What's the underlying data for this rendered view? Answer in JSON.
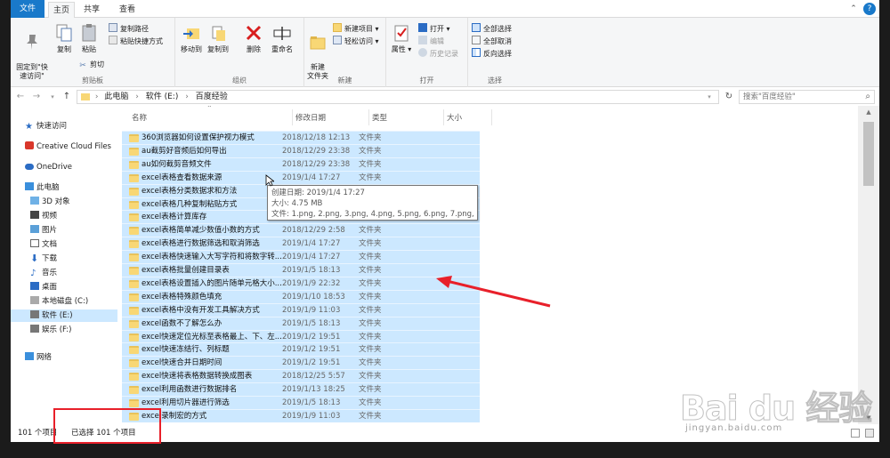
{
  "tabs": {
    "file": "文件",
    "home": "主页",
    "share": "共享",
    "view": "查看"
  },
  "ribbon": {
    "clipboard": {
      "label": "剪贴板",
      "pin": "固定到\"快\n速访问\"",
      "copy": "复制",
      "paste": "粘贴",
      "copy_path": "复制路径",
      "paste_shortcut": "粘贴快捷方式",
      "cut": "剪切"
    },
    "organize": {
      "label": "组织",
      "move_to": "移动到",
      "copy_to": "复制到",
      "delete": "删除",
      "rename": "重命名"
    },
    "new": {
      "label": "新建",
      "new_folder": "新建\n文件夹",
      "new_item": "新建项目",
      "easy_access": "轻松访问"
    },
    "open": {
      "label": "打开",
      "properties": "属性",
      "open": "打开",
      "edit": "编辑",
      "history": "历史记录"
    },
    "select": {
      "label": "选择",
      "select_all": "全部选择",
      "select_none": "全部取消",
      "invert": "反向选择"
    }
  },
  "address": {
    "crumbs": [
      "此电脑",
      "软件 (E:)",
      "百度经验"
    ],
    "search_placeholder": "搜索\"百度经验\""
  },
  "nav": {
    "quick_access": "快速访问",
    "creative_cloud": "Creative Cloud Files",
    "onedrive": "OneDrive",
    "this_pc": "此电脑",
    "objects3d": "3D 对象",
    "videos": "视频",
    "pictures": "图片",
    "documents": "文档",
    "downloads": "下载",
    "music": "音乐",
    "desktop": "桌面",
    "drive_c": "本地磁盘 (C:)",
    "drive_e": "软件 (E:)",
    "drive_f": "娱乐 (F:)",
    "network": "网络"
  },
  "columns": {
    "name": "名称",
    "date": "修改日期",
    "type": "类型",
    "size": "大小"
  },
  "files": [
    {
      "name": "360浏览器如何设置保护视力模式",
      "date": "2018/12/18 12:13",
      "type": "文件夹"
    },
    {
      "name": "au截剪好音频后如何导出",
      "date": "2018/12/29 23:38",
      "type": "文件夹"
    },
    {
      "name": "au如何截剪音频文件",
      "date": "2018/12/29 23:38",
      "type": "文件夹"
    },
    {
      "name": "excel表格查看数据来源",
      "date": "2019/1/4 17:27",
      "type": "文件夹"
    },
    {
      "name": "excel表格分类数据求和方法",
      "date": "",
      "type": ""
    },
    {
      "name": "excel表格几种复制粘贴方式",
      "date": "",
      "type": ""
    },
    {
      "name": "excel表格计算库存",
      "date": "",
      "type": ""
    },
    {
      "name": "excel表格简单减少数值小数的方式",
      "date": "2018/12/29 2:58",
      "type": "文件夹"
    },
    {
      "name": "excel表格进行数据筛选和取消筛选",
      "date": "2019/1/4 17:27",
      "type": "文件夹"
    },
    {
      "name": "excel表格快速输入大写字符和将数字转...",
      "date": "2019/1/4 17:27",
      "type": "文件夹"
    },
    {
      "name": "excel表格批量创建目录表",
      "date": "2019/1/5 18:13",
      "type": "文件夹"
    },
    {
      "name": "excel表格设置插入的图片随单元格大小...",
      "date": "2019/1/9 22:32",
      "type": "文件夹"
    },
    {
      "name": "excel表格特殊颜色填充",
      "date": "2019/1/10 18:53",
      "type": "文件夹"
    },
    {
      "name": "excel表格中没有开发工具解决方式",
      "date": "2019/1/9 11:03",
      "type": "文件夹"
    },
    {
      "name": "excel函数不了解怎么办",
      "date": "2019/1/5 18:13",
      "type": "文件夹"
    },
    {
      "name": "excel快速定位光标至表格最上、下、左...",
      "date": "2019/1/2 19:51",
      "type": "文件夹"
    },
    {
      "name": "excel快速冻结行、列标题",
      "date": "2019/1/2 19:51",
      "type": "文件夹"
    },
    {
      "name": "excel快速合并日期时间",
      "date": "2019/1/2 19:51",
      "type": "文件夹"
    },
    {
      "name": "excel快速将表格数据转换成图表",
      "date": "2018/12/25 5:57",
      "type": "文件夹"
    },
    {
      "name": "excel利用函数进行数据排名",
      "date": "2019/1/13 18:25",
      "type": "文件夹"
    },
    {
      "name": "excel利用切片器进行筛选",
      "date": "2019/1/5 18:13",
      "type": "文件夹"
    },
    {
      "name": "excel录制宏的方式",
      "date": "2019/1/9 11:03",
      "type": "文件夹"
    }
  ],
  "tooltip": {
    "created": "创建日期: 2019/1/4 17:27",
    "size": "大小: 4.75 MB",
    "files": "文件: 1.png, 2.png, 3.png, 4.png, 5.png, 6.png, 7.png, ..."
  },
  "status": {
    "count": "101 个项目",
    "selected": "已选择 101 个项目"
  },
  "watermark": {
    "logo": "Bai du 经验",
    "url": "jingyan.baidu.com"
  },
  "colors": {
    "accent": "#1979ca",
    "selection": "#cce8ff",
    "arrow": "#e8202a",
    "folder": "#f8d775"
  }
}
